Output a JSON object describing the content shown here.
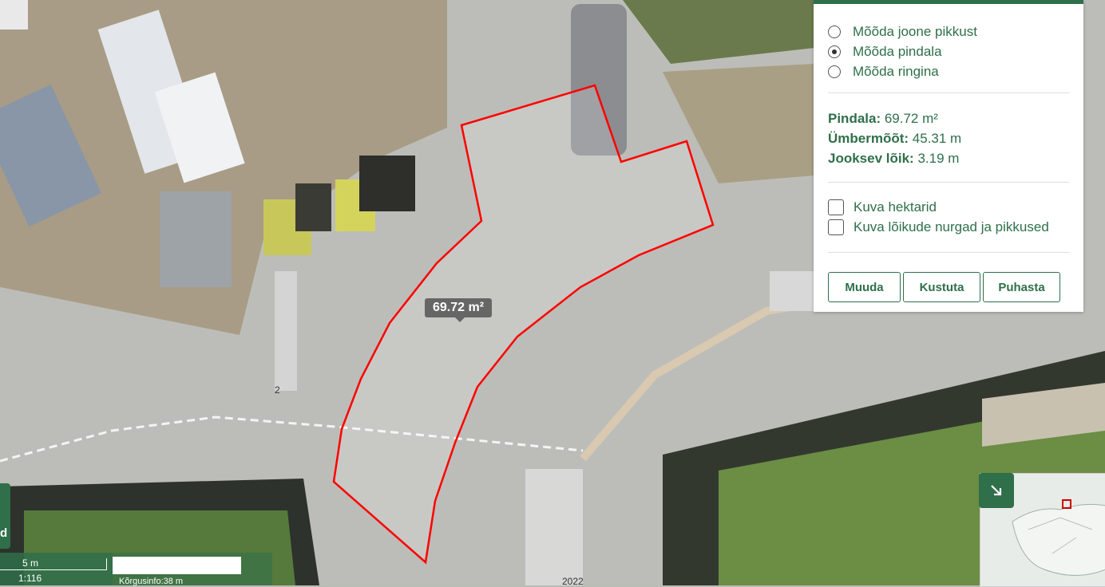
{
  "measure_options": [
    {
      "label": "Mõõda joone pikkust",
      "selected": false
    },
    {
      "label": "Mõõda pindala",
      "selected": true
    },
    {
      "label": "Mõõda ringina",
      "selected": false
    }
  ],
  "stats": {
    "area_label": "Pindala:",
    "area_value": " 69.72 m²",
    "perimeter_label": "Ümbermõõt:",
    "perimeter_value": " 45.31 m",
    "segment_label": "Jooksev lõik:",
    "segment_value": " 3.19 m"
  },
  "checkboxes": [
    {
      "label": "Kuva hektarid",
      "checked": false
    },
    {
      "label": "Kuva lõikude nurgad ja pikkused",
      "checked": false
    }
  ],
  "buttons": {
    "edit": "Muuda",
    "delete": "Kustuta",
    "clear": "Puhasta"
  },
  "map": {
    "area_label": "69.72 m²",
    "scale_distance": "5 m",
    "scale_ratio": "1:116",
    "elevation_info": "Kõrgusinfo:38 m",
    "left_edge_char": "d",
    "year_label": "2022",
    "stray_digit": "2"
  },
  "colors": {
    "accent": "#2f6f4a",
    "polygon": "#ff0000"
  }
}
